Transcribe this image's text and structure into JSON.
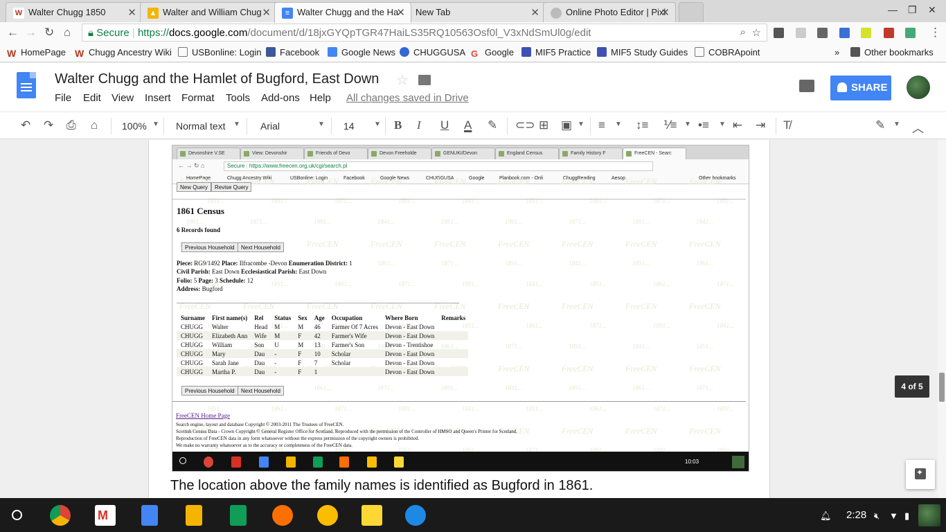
{
  "browser": {
    "tabs": [
      {
        "title": "Walter Chugg 1850",
        "favicon": "wiki-w-icon",
        "color": "#b3381f"
      },
      {
        "title": "Walter and William Chug",
        "favicon": "drive-icon",
        "color": "#f4b400"
      },
      {
        "title": "Walter Chugg and the Ha",
        "favicon": "docs-icon",
        "color": "#4285f4"
      },
      {
        "title": "New Tab",
        "favicon": "",
        "color": ""
      },
      {
        "title": "Online Photo Editor | Pixl",
        "favicon": "pixlr-icon",
        "color": "#bbbbbb"
      }
    ],
    "secure_label": "Secure",
    "url_prefix": "https://",
    "url_host": "docs.google.com",
    "url_path": "/document/d/18jxGYQpTGR47HaiLS35RQ10563Osf0l_V3xNdSmUl0g/edit",
    "bookmarks": [
      {
        "label": "HomePage",
        "icon": "wiki-w-icon",
        "color": "#b3381f"
      },
      {
        "label": "Chugg Ancestry Wiki",
        "icon": "wiki-w-icon",
        "color": "#b3381f"
      },
      {
        "label": "USBonline: Login",
        "icon": "page-icon",
        "color": "#ffffff"
      },
      {
        "label": "Facebook",
        "icon": "facebook-icon",
        "color": "#3b5998"
      },
      {
        "label": "Google News",
        "icon": "news-icon",
        "color": "#4285f4"
      },
      {
        "label": "CHUGGUSA",
        "icon": "globe-icon",
        "color": "#3367d6"
      },
      {
        "label": "Google",
        "icon": "google-icon",
        "color": "#ea4335"
      },
      {
        "label": "MIF5 Practice",
        "icon": "grid-icon",
        "color": "#3f51b5"
      },
      {
        "label": "MIF5 Study Guides",
        "icon": "grid-icon",
        "color": "#3f51b5"
      },
      {
        "label": "COBRApoint",
        "icon": "page-icon",
        "color": "#ffffff"
      }
    ],
    "more_bookmarks": "»",
    "other_bookmarks": "Other bookmarks"
  },
  "docs": {
    "title": "Walter Chugg and the Hamlet of Bugford, East Down",
    "menus": [
      "File",
      "Edit",
      "View",
      "Insert",
      "Format",
      "Tools",
      "Add-ons",
      "Help"
    ],
    "saved_status": "All changes saved in Drive",
    "share_label": "SHARE",
    "zoom": "100%",
    "style": "Normal text",
    "font": "Arial",
    "font_size": "14",
    "page_indicator": "4 of 5",
    "caption": "The location above the family names is identified as Bugford in 1861."
  },
  "shot": {
    "tabs": [
      "Devonshire V.SE",
      "View: Devonshir",
      "Friends of Devo",
      "Devon Freeholde",
      "GENUKI/Devon",
      "England Census",
      "Family History F",
      "FreeCEN - Searc"
    ],
    "secure_label": "Secure",
    "url": "https://www.freecen.org.uk/cgi/search.pl",
    "bookmarks": [
      "HomePage",
      "Chugg Ancestry Wiki",
      "USBonline: Login",
      "Facebook",
      "Google News",
      "CHUGGUSA",
      "Google",
      "Planbook.com - Onli",
      "ChuggReading",
      "Aesop",
      "Other bookmarks"
    ],
    "top_buttons": [
      "New Query",
      "Revise Query"
    ],
    "census_title": "1861 Census",
    "records_found": "6 Records found",
    "prev_household": "Previous Household",
    "next_household": "Next Household",
    "meta": {
      "piece_label": "Piece:",
      "piece": "RG9/1492",
      "place_label": "Place:",
      "place": "Ilfracombe -Devon",
      "enum_label": "Enumeration District:",
      "enum": "1",
      "civil_label": "Civil Parish:",
      "civil": "East Down",
      "eccl_label": "Ecclesiastical Parish:",
      "eccl": "East Down",
      "folio_label": "Folio:",
      "folio": "5",
      "page_label": "Page:",
      "page": "3",
      "schedule_label": "Schedule:",
      "schedule": "12",
      "address_label": "Address:",
      "address": "Bugford"
    },
    "table": {
      "headers": [
        "Surname",
        "First name(s)",
        "Rel",
        "Status",
        "Sex",
        "Age",
        "Occupation",
        "Where Born",
        "Remarks"
      ],
      "rows": [
        [
          "CHUGG",
          "Walter",
          "Head",
          "M",
          "M",
          "46",
          "Farmer Of 7 Acres",
          "Devon - East Down",
          ""
        ],
        [
          "CHUGG",
          "Elizabeth Ann",
          "Wife",
          "M",
          "F",
          "42",
          "Farmer's Wife",
          "Devon - East Down",
          ""
        ],
        [
          "CHUGG",
          "William",
          "Son",
          "U",
          "M",
          "13",
          "Farmer's Son",
          "Devon - Trentishoe",
          ""
        ],
        [
          "CHUGG",
          "Mary",
          "Dau",
          "-",
          "F",
          "10",
          "Scholar",
          "Devon - East Down",
          ""
        ],
        [
          "CHUGG",
          "Sarah Jane",
          "Dau",
          "-",
          "F",
          "7",
          "Scholar",
          "Devon - East Down",
          ""
        ],
        [
          "CHUGG",
          "Martha P.",
          "Dau",
          "-",
          "F",
          "1",
          "",
          "Devon - East Down",
          ""
        ]
      ]
    },
    "home_link": "FreeCEN Home Page",
    "footer": [
      "Search engine, layout and database Copyright © 2003-2011 The Trustees of FreeCEN.",
      "Scottish Census Data - Crown Copyright © General Register Office for Scotland. Reproduced with the permission of the Controller of HMSO and Queen's Printer for Scotland.",
      "Reproduction of FreeCEN data in any form whatsoever without the express permission of the copyright owners is prohibited.",
      "We make no warranty whatsoever as to the accuracy or completeness of the FreeCEN data."
    ],
    "watermark": "FreeCEN",
    "watermark_years": [
      "1841...",
      "1851...",
      "1861...",
      "1871...",
      "1891..."
    ],
    "clock": "10:03"
  },
  "os": {
    "clock": "2:28",
    "shelf_apps": [
      {
        "name": "chrome-icon",
        "color": "#db4437"
      },
      {
        "name": "gmail-icon",
        "color": "#d93025"
      },
      {
        "name": "docs-icon",
        "color": "#4285f4"
      },
      {
        "name": "slides-icon",
        "color": "#f4b400"
      },
      {
        "name": "sheets-icon",
        "color": "#0f9d58"
      },
      {
        "name": "play-music-icon",
        "color": "#ff6f00"
      },
      {
        "name": "keep-icon",
        "color": "#fbbc04"
      },
      {
        "name": "notes-icon",
        "color": "#fdd835"
      },
      {
        "name": "files-icon",
        "color": "#1e88e5"
      }
    ]
  }
}
